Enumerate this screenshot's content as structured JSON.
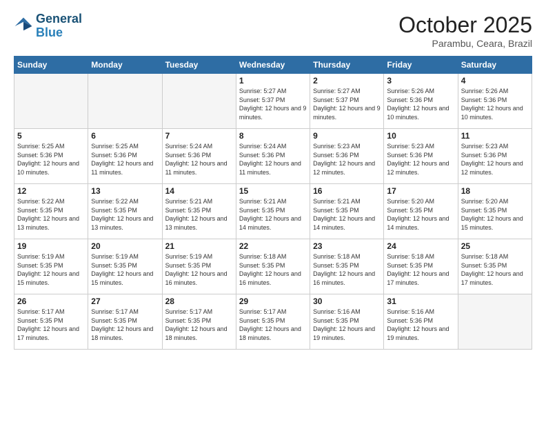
{
  "header": {
    "logo_line1": "General",
    "logo_line2": "Blue",
    "month": "October 2025",
    "location": "Parambu, Ceara, Brazil"
  },
  "weekdays": [
    "Sunday",
    "Monday",
    "Tuesday",
    "Wednesday",
    "Thursday",
    "Friday",
    "Saturday"
  ],
  "weeks": [
    [
      {
        "day": "",
        "empty": true
      },
      {
        "day": "",
        "empty": true
      },
      {
        "day": "",
        "empty": true
      },
      {
        "day": "1",
        "sunrise": "5:27 AM",
        "sunset": "5:37 PM",
        "daylight": "12 hours and 9 minutes."
      },
      {
        "day": "2",
        "sunrise": "5:27 AM",
        "sunset": "5:37 PM",
        "daylight": "12 hours and 9 minutes."
      },
      {
        "day": "3",
        "sunrise": "5:26 AM",
        "sunset": "5:36 PM",
        "daylight": "12 hours and 10 minutes."
      },
      {
        "day": "4",
        "sunrise": "5:26 AM",
        "sunset": "5:36 PM",
        "daylight": "12 hours and 10 minutes."
      }
    ],
    [
      {
        "day": "5",
        "sunrise": "5:25 AM",
        "sunset": "5:36 PM",
        "daylight": "12 hours and 10 minutes."
      },
      {
        "day": "6",
        "sunrise": "5:25 AM",
        "sunset": "5:36 PM",
        "daylight": "12 hours and 11 minutes."
      },
      {
        "day": "7",
        "sunrise": "5:24 AM",
        "sunset": "5:36 PM",
        "daylight": "12 hours and 11 minutes."
      },
      {
        "day": "8",
        "sunrise": "5:24 AM",
        "sunset": "5:36 PM",
        "daylight": "12 hours and 11 minutes."
      },
      {
        "day": "9",
        "sunrise": "5:23 AM",
        "sunset": "5:36 PM",
        "daylight": "12 hours and 12 minutes."
      },
      {
        "day": "10",
        "sunrise": "5:23 AM",
        "sunset": "5:36 PM",
        "daylight": "12 hours and 12 minutes."
      },
      {
        "day": "11",
        "sunrise": "5:23 AM",
        "sunset": "5:36 PM",
        "daylight": "12 hours and 12 minutes."
      }
    ],
    [
      {
        "day": "12",
        "sunrise": "5:22 AM",
        "sunset": "5:35 PM",
        "daylight": "12 hours and 13 minutes."
      },
      {
        "day": "13",
        "sunrise": "5:22 AM",
        "sunset": "5:35 PM",
        "daylight": "12 hours and 13 minutes."
      },
      {
        "day": "14",
        "sunrise": "5:21 AM",
        "sunset": "5:35 PM",
        "daylight": "12 hours and 13 minutes."
      },
      {
        "day": "15",
        "sunrise": "5:21 AM",
        "sunset": "5:35 PM",
        "daylight": "12 hours and 14 minutes."
      },
      {
        "day": "16",
        "sunrise": "5:21 AM",
        "sunset": "5:35 PM",
        "daylight": "12 hours and 14 minutes."
      },
      {
        "day": "17",
        "sunrise": "5:20 AM",
        "sunset": "5:35 PM",
        "daylight": "12 hours and 14 minutes."
      },
      {
        "day": "18",
        "sunrise": "5:20 AM",
        "sunset": "5:35 PM",
        "daylight": "12 hours and 15 minutes."
      }
    ],
    [
      {
        "day": "19",
        "sunrise": "5:19 AM",
        "sunset": "5:35 PM",
        "daylight": "12 hours and 15 minutes."
      },
      {
        "day": "20",
        "sunrise": "5:19 AM",
        "sunset": "5:35 PM",
        "daylight": "12 hours and 15 minutes."
      },
      {
        "day": "21",
        "sunrise": "5:19 AM",
        "sunset": "5:35 PM",
        "daylight": "12 hours and 16 minutes."
      },
      {
        "day": "22",
        "sunrise": "5:18 AM",
        "sunset": "5:35 PM",
        "daylight": "12 hours and 16 minutes."
      },
      {
        "day": "23",
        "sunrise": "5:18 AM",
        "sunset": "5:35 PM",
        "daylight": "12 hours and 16 minutes."
      },
      {
        "day": "24",
        "sunrise": "5:18 AM",
        "sunset": "5:35 PM",
        "daylight": "12 hours and 17 minutes."
      },
      {
        "day": "25",
        "sunrise": "5:18 AM",
        "sunset": "5:35 PM",
        "daylight": "12 hours and 17 minutes."
      }
    ],
    [
      {
        "day": "26",
        "sunrise": "5:17 AM",
        "sunset": "5:35 PM",
        "daylight": "12 hours and 17 minutes."
      },
      {
        "day": "27",
        "sunrise": "5:17 AM",
        "sunset": "5:35 PM",
        "daylight": "12 hours and 18 minutes."
      },
      {
        "day": "28",
        "sunrise": "5:17 AM",
        "sunset": "5:35 PM",
        "daylight": "12 hours and 18 minutes."
      },
      {
        "day": "29",
        "sunrise": "5:17 AM",
        "sunset": "5:35 PM",
        "daylight": "12 hours and 18 minutes."
      },
      {
        "day": "30",
        "sunrise": "5:16 AM",
        "sunset": "5:35 PM",
        "daylight": "12 hours and 19 minutes."
      },
      {
        "day": "31",
        "sunrise": "5:16 AM",
        "sunset": "5:36 PM",
        "daylight": "12 hours and 19 minutes."
      },
      {
        "day": "",
        "empty": true
      }
    ]
  ]
}
